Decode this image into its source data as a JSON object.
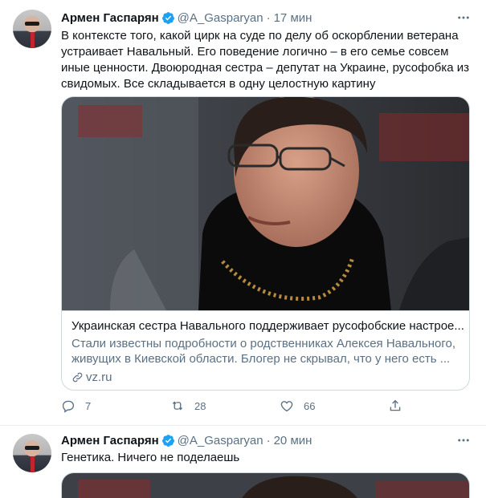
{
  "tweets": [
    {
      "author_name": "Армен Гаспарян",
      "handle": "@A_Gasparyan",
      "separator": "·",
      "time": "17 мин",
      "text_lines": [
        "В контексте того, какой цирк на суде по делу об оскорблении ветерана",
        "устраивает Навальный. Его поведение логично – в его семье совсем",
        "иные ценности. Двоюродная сестра – депутат на Украине, русофобка из",
        "свидомых. Все складывается в одну целостную картину"
      ],
      "card": {
        "title": "Украинская сестра Навального поддерживает русофобские настрое...",
        "description_lines": [
          "Стали известны подробности о родственниках Алексея Навального,",
          "живущих в Киевской области. Блогер не скрывал, что у него есть ..."
        ],
        "domain": "vz.ru"
      },
      "actions": {
        "replies": "7",
        "retweets": "28",
        "likes": "66"
      }
    },
    {
      "author_name": "Армен Гаспарян",
      "handle": "@A_Gasparyan",
      "separator": "·",
      "time": "20 мин",
      "text_lines": [
        "Генетика. Ничего не поделаешь"
      ]
    }
  ],
  "colors": {
    "accent": "#1da1f2",
    "secondary_text": "#5b7083",
    "border": "#cfd9de"
  },
  "icons": [
    "verified-badge-icon",
    "more-icon",
    "link-icon",
    "reply-icon",
    "retweet-icon",
    "like-icon",
    "share-icon"
  ]
}
